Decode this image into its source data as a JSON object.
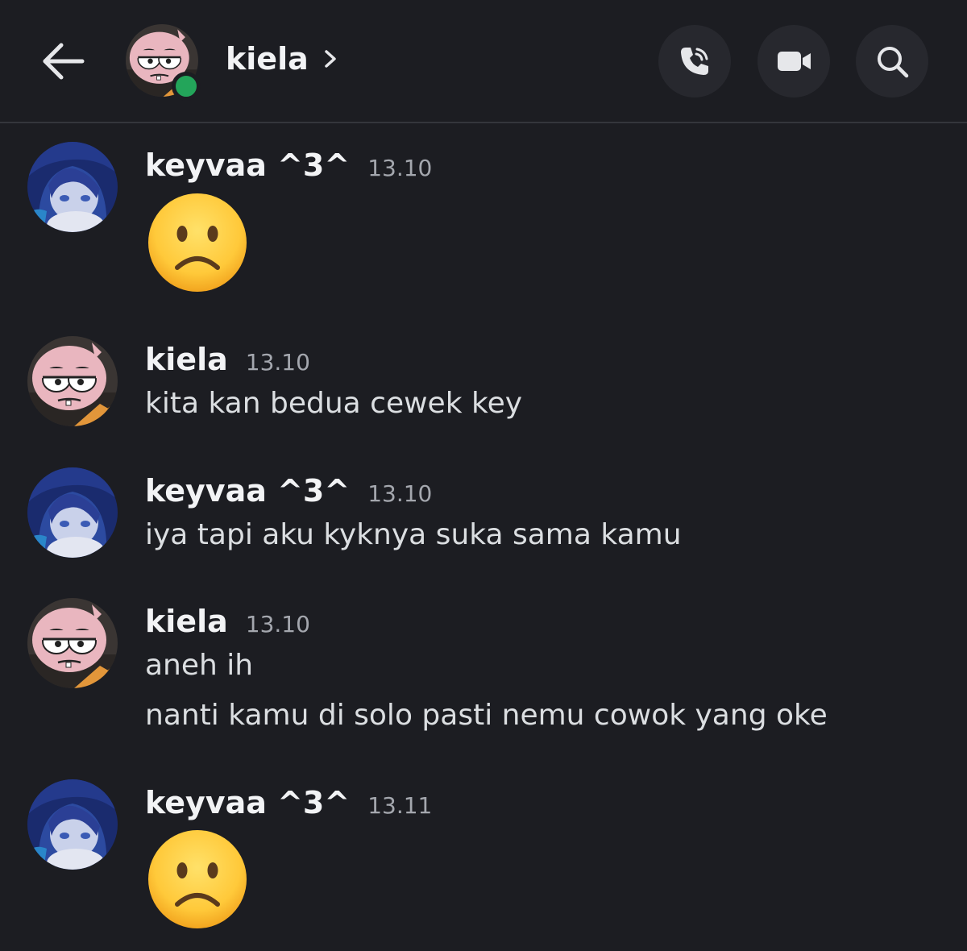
{
  "header": {
    "contact_name": "kiela",
    "status": "online",
    "status_color": "#23a55a",
    "back_icon": "arrow-left-icon",
    "chevron_icon": "chevron-right-icon",
    "actions": [
      {
        "name": "voice-call",
        "icon": "phone-icon"
      },
      {
        "name": "video-call",
        "icon": "video-camera-icon"
      },
      {
        "name": "search",
        "icon": "search-icon"
      }
    ]
  },
  "messages": [
    {
      "author": "keyvaa ^3^",
      "time": "13.10",
      "emoji": "slightly-frowning-face"
    },
    {
      "author": "kiela",
      "time": "13.10",
      "lines": [
        "kita kan bedua cewek key"
      ]
    },
    {
      "author": "keyvaa ^3^",
      "time": "13.10",
      "lines": [
        "iya tapi aku kyknya suka sama kamu"
      ]
    },
    {
      "author": "kiela",
      "time": "13.10",
      "lines": [
        "aneh ih",
        "nanti kamu di solo pasti nemu cowok yang oke"
      ]
    },
    {
      "author": "keyvaa ^3^",
      "time": "13.11",
      "emoji": "slightly-frowning-face"
    }
  ],
  "colors": {
    "background": "#1c1d22",
    "author_text": "#f2f3f5",
    "message_text": "#dbdee1",
    "timestamp": "#a4a7ae"
  }
}
